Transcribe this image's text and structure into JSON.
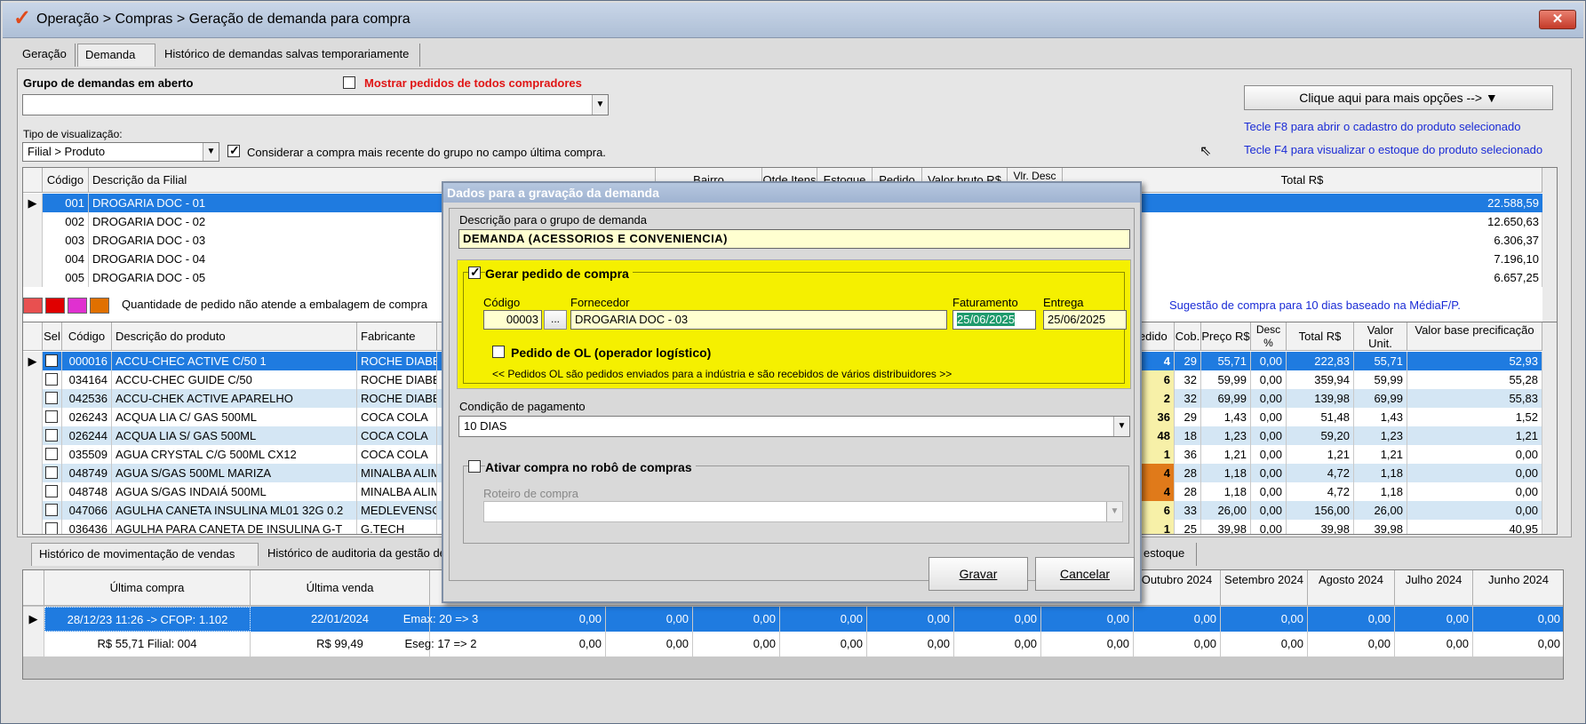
{
  "window": {
    "title": "Operação > Compras > Geração de demanda para compra",
    "close": "✕"
  },
  "tabs": [
    "Geração",
    "Demanda",
    "Histórico de demandas salvas temporariamente"
  ],
  "top": {
    "group_label": "Grupo de demandas em aberto",
    "show_all_label": "Mostrar pedidos de todos compradores",
    "view_type_label": "Tipo de visualização:",
    "view_type_value": "Filial > Produto",
    "consider_label": "Considerar a compra mais recente do grupo no campo última compra.",
    "options_button": "Clique aqui para mais opções -->",
    "hint_f8": "Tecle F8 para abrir o cadastro do produto selecionado",
    "hint_f4": "Tecle F4 para visualizar o estoque do produto selecionado"
  },
  "branches": {
    "headers": [
      "Código",
      "Descrição da Filial",
      "Bairro",
      "Qtde Itens",
      "Estoque",
      "Pedido",
      "Valor bruto R$",
      "Vlr. Desc",
      "Total R$"
    ],
    "rows": [
      {
        "code": "001",
        "name": "DROGARIA DOC - 01",
        "total": "22.588,59"
      },
      {
        "code": "002",
        "name": "DROGARIA DOC - 02",
        "total": "12.650,63"
      },
      {
        "code": "003",
        "name": "DROGARIA DOC - 03",
        "total": "6.306,37"
      },
      {
        "code": "004",
        "name": "DROGARIA DOC - 04",
        "total": "7.196,10"
      },
      {
        "code": "005",
        "name": "DROGARIA DOC - 05",
        "total": "6.657,25"
      }
    ]
  },
  "legend": {
    "text": "Quantidade de pedido não atende a embalagem de compra",
    "suggestion": "Sugestão de compra para 10 dias baseado na MédiaF/P.",
    "colors": [
      "#e85050",
      "#e00000",
      "#e030d0",
      "#e07000"
    ]
  },
  "products": {
    "headers": [
      "Sel",
      "Código",
      "Descrição do produto",
      "Fabricante",
      "Pedido",
      "Cob.",
      "Preço R$",
      "Desc %",
      "Total R$",
      "Valor Unit.",
      "Valor base precificação"
    ],
    "rows": [
      {
        "code": "000016",
        "desc": "ACCU-CHEC ACTIVE C/50 1",
        "maker": "ROCHE DIABE",
        "ped": "4",
        "cob": "29",
        "preco": "55,71",
        "desc_pct": "0,00",
        "total": "222,83",
        "unit": "55,71",
        "base": "52,93"
      },
      {
        "code": "034164",
        "desc": "ACCU-CHEC GUIDE C/50",
        "maker": "ROCHE DIABE",
        "ped": "6",
        "cob": "32",
        "preco": "59,99",
        "desc_pct": "0,00",
        "total": "359,94",
        "unit": "59,99",
        "base": "55,28"
      },
      {
        "code": "042536",
        "desc": "ACCU-CHEK ACTIVE APARELHO",
        "maker": "ROCHE DIABE",
        "ped": "2",
        "cob": "32",
        "preco": "69,99",
        "desc_pct": "0,00",
        "total": "139,98",
        "unit": "69,99",
        "base": "55,83"
      },
      {
        "code": "026243",
        "desc": "ACQUA LIA C/ GAS 500ML",
        "maker": "COCA COLA",
        "ped": "36",
        "cob": "29",
        "preco": "1,43",
        "desc_pct": "0,00",
        "total": "51,48",
        "unit": "1,43",
        "base": "1,52"
      },
      {
        "code": "026244",
        "desc": "ACQUA LIA S/ GAS 500ML",
        "maker": "COCA COLA",
        "ped": "48",
        "cob": "18",
        "preco": "1,23",
        "desc_pct": "0,00",
        "total": "59,20",
        "unit": "1,23",
        "base": "1,21"
      },
      {
        "code": "035509",
        "desc": "AGUA CRYSTAL C/G 500ML CX12",
        "maker": "COCA COLA",
        "ped": "1",
        "cob": "36",
        "preco": "1,21",
        "desc_pct": "0,00",
        "total": "1,21",
        "unit": "1,21",
        "base": "0,00"
      },
      {
        "code": "048749",
        "desc": "AGUA S/GAS 500ML MARIZA",
        "maker": "MINALBA ALIM",
        "ped": "4",
        "cob": "28",
        "preco": "1,18",
        "desc_pct": "0,00",
        "total": "4,72",
        "unit": "1,18",
        "base": "0,00"
      },
      {
        "code": "048748",
        "desc": "AGUA S/GAS INDAIÁ 500ML",
        "maker": "MINALBA ALIM",
        "ped": "4",
        "cob": "28",
        "preco": "1,18",
        "desc_pct": "0,00",
        "total": "4,72",
        "unit": "1,18",
        "base": "0,00"
      },
      {
        "code": "047066",
        "desc": "AGULHA CANETA INSULINA ML01 32G 0.2",
        "maker": "MEDLEVENSO",
        "ped": "6",
        "cob": "33",
        "preco": "26,00",
        "desc_pct": "0,00",
        "total": "156,00",
        "unit": "26,00",
        "base": "0,00"
      },
      {
        "code": "036436",
        "desc": "AGULHA PARA CANETA DE INSULINA G-T",
        "maker": "G.TECH",
        "ped": "1",
        "cob": "25",
        "preco": "39,98",
        "desc_pct": "0,00",
        "total": "39,98",
        "unit": "39,98",
        "base": "40,95"
      }
    ]
  },
  "bottom_tabs": [
    "Histórico de movimentação de vendas",
    "Histórico de auditoria da gestão de es",
    "estoque"
  ],
  "history": {
    "headers": [
      "Última compra",
      "Última venda",
      "",
      "Outubro 2024",
      "Setembro 2024",
      "Agosto 2024",
      "Julho 2024",
      "Junho 2024"
    ],
    "row1": {
      "compra": "28/12/23 11:26 -> CFOP: 1.102",
      "venda": "22/01/2024",
      "emax": "Emax: 20 => 3"
    },
    "row2": {
      "compra": "R$ 55,71 Filial: 004",
      "venda": "R$ 99,49",
      "eseg": "Eseg: 17 => 2"
    },
    "zero": "0,00"
  },
  "dialog": {
    "title": "Dados para a gravação da demanda",
    "desc_label": "Descrição para o grupo de demanda",
    "desc_value": "DEMANDA (ACESSORIOS E CONVENIENCIA)",
    "gerar_label": "Gerar pedido de compra",
    "codigo_label": "Código",
    "codigo_value": "00003",
    "ellipsis": "...",
    "fornecedor_label": "Fornecedor",
    "fornecedor_value": "DROGARIA DOC - 03",
    "faturamento_label": "Faturamento",
    "faturamento_value": "25/06/2025",
    "entrega_label": "Entrega",
    "entrega_value": "25/06/2025",
    "ol_label": "Pedido de OL (operador logístico)",
    "ol_note": "<< Pedidos OL são pedidos enviados para a indústria e são recebidos de vários distribuidores >>",
    "cond_label": "Condição de pagamento",
    "cond_value": "10 DIAS",
    "robo_label": "Ativar compra no robô de compras",
    "roteiro_label": "Roteiro de compra",
    "gravar": "Gravar",
    "cancelar": "Cancelar"
  }
}
